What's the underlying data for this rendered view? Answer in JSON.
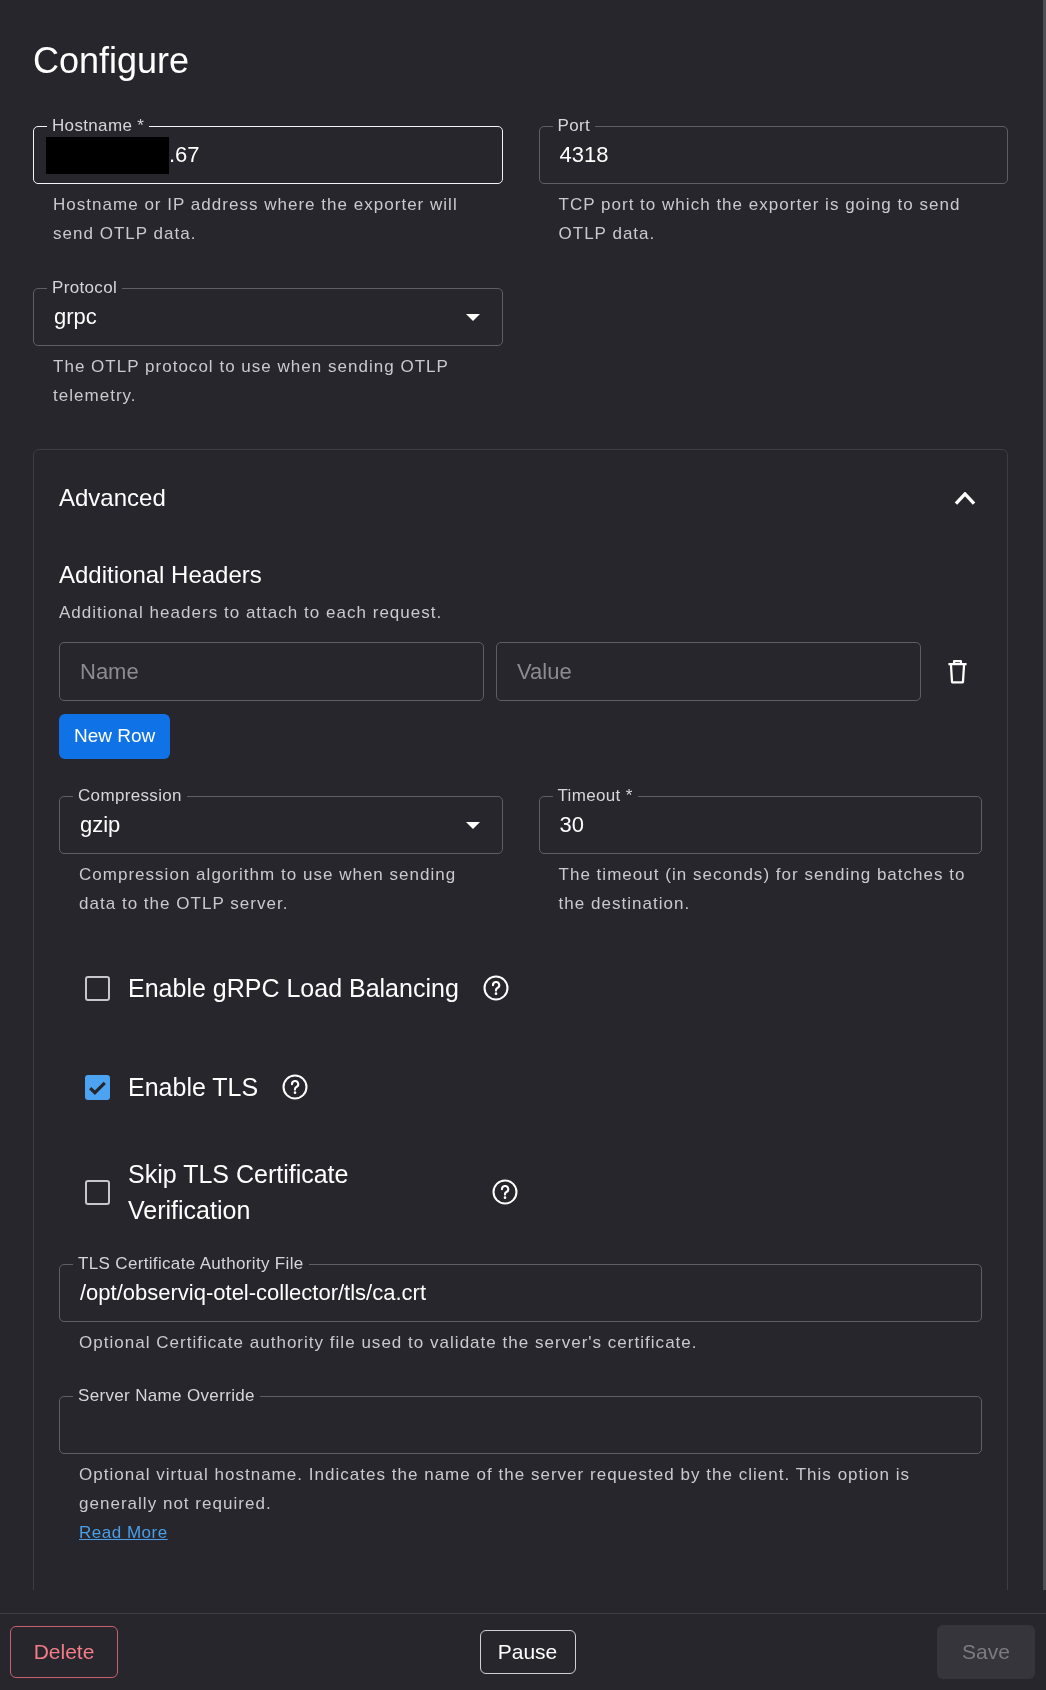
{
  "page": {
    "title": "Configure"
  },
  "fields": [
    {
      "kind": "text",
      "label": "Hostname *",
      "value": ".67",
      "redacted": true,
      "focused": true,
      "helper": "Hostname or IP address where the exporter will send OTLP data."
    },
    {
      "kind": "text",
      "label": "Port",
      "value": "4318",
      "focused": false,
      "helper": "TCP port to which the exporter is going to send OTLP data."
    },
    {
      "kind": "select",
      "label": "Protocol",
      "value": "grpc",
      "focused": false,
      "helper": "The OTLP protocol to use when sending OTLP telemetry."
    }
  ],
  "advanced": {
    "title": "Advanced",
    "expanded": true,
    "headers": {
      "title": "Additional Headers",
      "description": "Additional headers to attach to each request.",
      "rows": [
        {
          "name_placeholder": "Name",
          "value_placeholder": "Value"
        }
      ],
      "button": "New Row"
    },
    "fields": [
      {
        "kind": "select",
        "label": "Compression",
        "value": "gzip",
        "focused": false,
        "helper": "Compression algorithm to use when sending data to the OTLP server."
      },
      {
        "kind": "text",
        "label": "Timeout *",
        "value": "30",
        "focused": false,
        "helper": "The timeout (in seconds) for sending batches to the destination."
      }
    ],
    "options": [
      {
        "label": "Enable gRPC Load Balancing",
        "checked": false
      },
      {
        "label": "Enable TLS",
        "checked": true
      },
      {
        "label": "Skip TLS Certificate Verification",
        "checked": false
      }
    ],
    "tls_fields": [
      {
        "kind": "text",
        "label": "TLS Certificate Authority File",
        "value": "/opt/observiq-otel-collector/tls/ca.crt",
        "focused": false,
        "helper": "Optional Certificate authority file used to validate the server's certificate."
      },
      {
        "kind": "text",
        "label": "Server Name Override",
        "focused": false,
        "helper": "Optional virtual hostname. Indicates the name of the server requested by the client. This option is generally not required.",
        "link": "Read More"
      }
    ]
  },
  "footer": {
    "buttons": [
      {
        "label": "Delete",
        "kind": "danger",
        "disabled": false
      },
      {
        "label": "Pause",
        "kind": "outline",
        "disabled": false
      },
      {
        "label": "Save",
        "kind": "primary",
        "disabled": true
      }
    ]
  }
}
